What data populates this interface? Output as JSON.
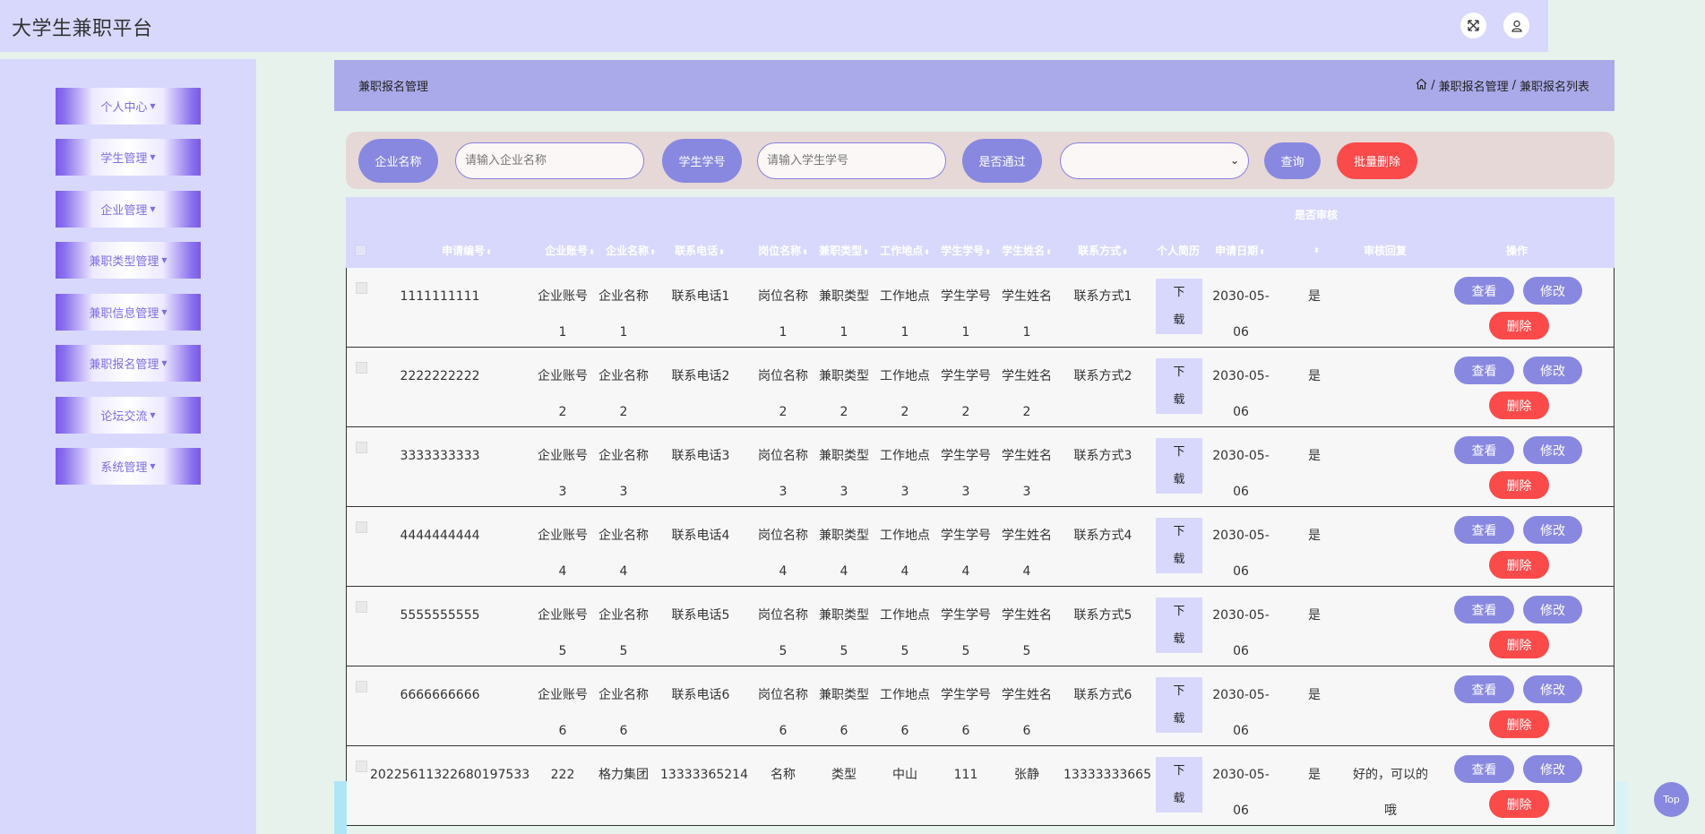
{
  "app": {
    "title": "大学生兼职平台"
  },
  "header": {
    "icons": [
      "fullscreen-icon",
      "user-icon"
    ]
  },
  "sidebar": {
    "items": [
      {
        "label": "个人中心"
      },
      {
        "label": "学生管理"
      },
      {
        "label": "企业管理"
      },
      {
        "label": "兼职类型管理"
      },
      {
        "label": "兼职信息管理"
      },
      {
        "label": "兼职报名管理"
      },
      {
        "label": "论坛交流"
      },
      {
        "label": "系统管理"
      }
    ]
  },
  "breadcrumb_bar": {
    "title": "兼职报名管理",
    "crumbs": [
      "兼职报名管理",
      "兼职报名列表"
    ],
    "separator": "/"
  },
  "search": {
    "company_label": "企业名称",
    "company_placeholder": "请输入企业名称",
    "student_label": "学生学号",
    "student_placeholder": "请输入学生学号",
    "passed_label": "是否通过",
    "passed_value": "",
    "query_label": "查询",
    "batch_delete_label": "批量删除"
  },
  "table": {
    "headers": {
      "apply_no": "申请编号",
      "company_account": "企业账号",
      "company_name": "企业名称",
      "phone": "联系电话",
      "job_name": "岗位名称",
      "job_type": "兼职类型",
      "location": "工作地点",
      "student_no": "学生学号",
      "student_name": "学生姓名",
      "contact": "联系方式",
      "resume": "个人简历",
      "apply_date": "申请日期",
      "reviewed": "是否审核",
      "review_reply": "审核回复",
      "actions": "操作"
    },
    "download_label": [
      "下",
      "载"
    ],
    "action_labels": {
      "view": "查看",
      "edit": "修改",
      "delete": "删除"
    },
    "rows": [
      {
        "apply_no": "1111111111",
        "company_account": [
          "企业账号",
          "1"
        ],
        "company_name": [
          "企业名称",
          "1"
        ],
        "phone": "联系电话1",
        "job_name": [
          "岗位名称",
          "1"
        ],
        "job_type": [
          "兼职类型",
          "1"
        ],
        "location": [
          "工作地点",
          "1"
        ],
        "student_no": [
          "学生学号",
          "1"
        ],
        "student_name": [
          "学生姓名",
          "1"
        ],
        "contact": "联系方式1",
        "apply_date": [
          "2030-05-",
          "06"
        ],
        "reviewed": "是",
        "review_reply": [
          "",
          ""
        ]
      },
      {
        "apply_no": "2222222222",
        "company_account": [
          "企业账号",
          "2"
        ],
        "company_name": [
          "企业名称",
          "2"
        ],
        "phone": "联系电话2",
        "job_name": [
          "岗位名称",
          "2"
        ],
        "job_type": [
          "兼职类型",
          "2"
        ],
        "location": [
          "工作地点",
          "2"
        ],
        "student_no": [
          "学生学号",
          "2"
        ],
        "student_name": [
          "学生姓名",
          "2"
        ],
        "contact": "联系方式2",
        "apply_date": [
          "2030-05-",
          "06"
        ],
        "reviewed": "是",
        "review_reply": [
          "",
          ""
        ]
      },
      {
        "apply_no": "3333333333",
        "company_account": [
          "企业账号",
          "3"
        ],
        "company_name": [
          "企业名称",
          "3"
        ],
        "phone": "联系电话3",
        "job_name": [
          "岗位名称",
          "3"
        ],
        "job_type": [
          "兼职类型",
          "3"
        ],
        "location": [
          "工作地点",
          "3"
        ],
        "student_no": [
          "学生学号",
          "3"
        ],
        "student_name": [
          "学生姓名",
          "3"
        ],
        "contact": "联系方式3",
        "apply_date": [
          "2030-05-",
          "06"
        ],
        "reviewed": "是",
        "review_reply": [
          "",
          ""
        ]
      },
      {
        "apply_no": "4444444444",
        "company_account": [
          "企业账号",
          "4"
        ],
        "company_name": [
          "企业名称",
          "4"
        ],
        "phone": "联系电话4",
        "job_name": [
          "岗位名称",
          "4"
        ],
        "job_type": [
          "兼职类型",
          "4"
        ],
        "location": [
          "工作地点",
          "4"
        ],
        "student_no": [
          "学生学号",
          "4"
        ],
        "student_name": [
          "学生姓名",
          "4"
        ],
        "contact": "联系方式4",
        "apply_date": [
          "2030-05-",
          "06"
        ],
        "reviewed": "是",
        "review_reply": [
          "",
          ""
        ]
      },
      {
        "apply_no": "5555555555",
        "company_account": [
          "企业账号",
          "5"
        ],
        "company_name": [
          "企业名称",
          "5"
        ],
        "phone": "联系电话5",
        "job_name": [
          "岗位名称",
          "5"
        ],
        "job_type": [
          "兼职类型",
          "5"
        ],
        "location": [
          "工作地点",
          "5"
        ],
        "student_no": [
          "学生学号",
          "5"
        ],
        "student_name": [
          "学生姓名",
          "5"
        ],
        "contact": "联系方式5",
        "apply_date": [
          "2030-05-",
          "06"
        ],
        "reviewed": "是",
        "review_reply": [
          "",
          ""
        ]
      },
      {
        "apply_no": "6666666666",
        "company_account": [
          "企业账号",
          "6"
        ],
        "company_name": [
          "企业名称",
          "6"
        ],
        "phone": "联系电话6",
        "job_name": [
          "岗位名称",
          "6"
        ],
        "job_type": [
          "兼职类型",
          "6"
        ],
        "location": [
          "工作地点",
          "6"
        ],
        "student_no": [
          "学生学号",
          "6"
        ],
        "student_name": [
          "学生姓名",
          "6"
        ],
        "contact": "联系方式6",
        "apply_date": [
          "2030-05-",
          "06"
        ],
        "reviewed": "是",
        "review_reply": [
          "",
          ""
        ]
      },
      {
        "apply_no": "20225611322680197533",
        "company_account": [
          "222",
          ""
        ],
        "company_name": [
          "格力集团",
          ""
        ],
        "phone": "13333365214",
        "job_name": [
          "名称",
          ""
        ],
        "job_type": [
          "类型",
          ""
        ],
        "location": [
          "中山",
          ""
        ],
        "student_no": [
          "111",
          ""
        ],
        "student_name": [
          "张静",
          ""
        ],
        "contact": "13333333665",
        "apply_date": [
          "2030-05-",
          "06"
        ],
        "reviewed": "是",
        "review_reply": [
          "好的，可以的",
          "哦"
        ]
      }
    ]
  },
  "scroll_top_label": "Top",
  "colors": {
    "page_bg": "#e7f2ec",
    "header_bg": "#d8d8fc",
    "breadbar_bg": "#aaaaea",
    "accent": "#8888e0",
    "danger": "#fa4a4a"
  }
}
